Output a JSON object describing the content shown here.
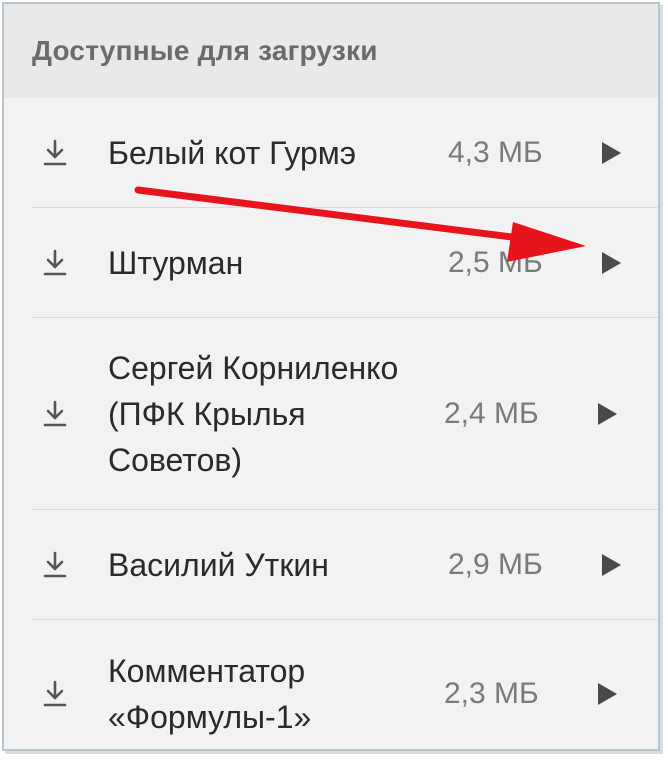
{
  "section": {
    "title": "Доступные для загрузки"
  },
  "tracks": [
    {
      "name": "Белый кот Гурмэ",
      "size": "4,3 МБ"
    },
    {
      "name": "Штурман",
      "size": "2,5 МБ"
    },
    {
      "name": "Сергей Корниленко (ПФК Крылья Советов)",
      "size": "2,4 МБ"
    },
    {
      "name": "Василий Уткин",
      "size": "2,9 МБ"
    },
    {
      "name": "Комментатор «Формулы-1»",
      "size": "2,3 МБ"
    }
  ],
  "icons": {
    "download": "download-icon",
    "play": "play-icon"
  },
  "colors": {
    "annotation_arrow": "#e8141c",
    "header_bg": "#e9e9e9",
    "list_bg": "#f2f2f2",
    "primary_text": "#2a2a2a",
    "secondary_text": "#7a7a7a"
  }
}
